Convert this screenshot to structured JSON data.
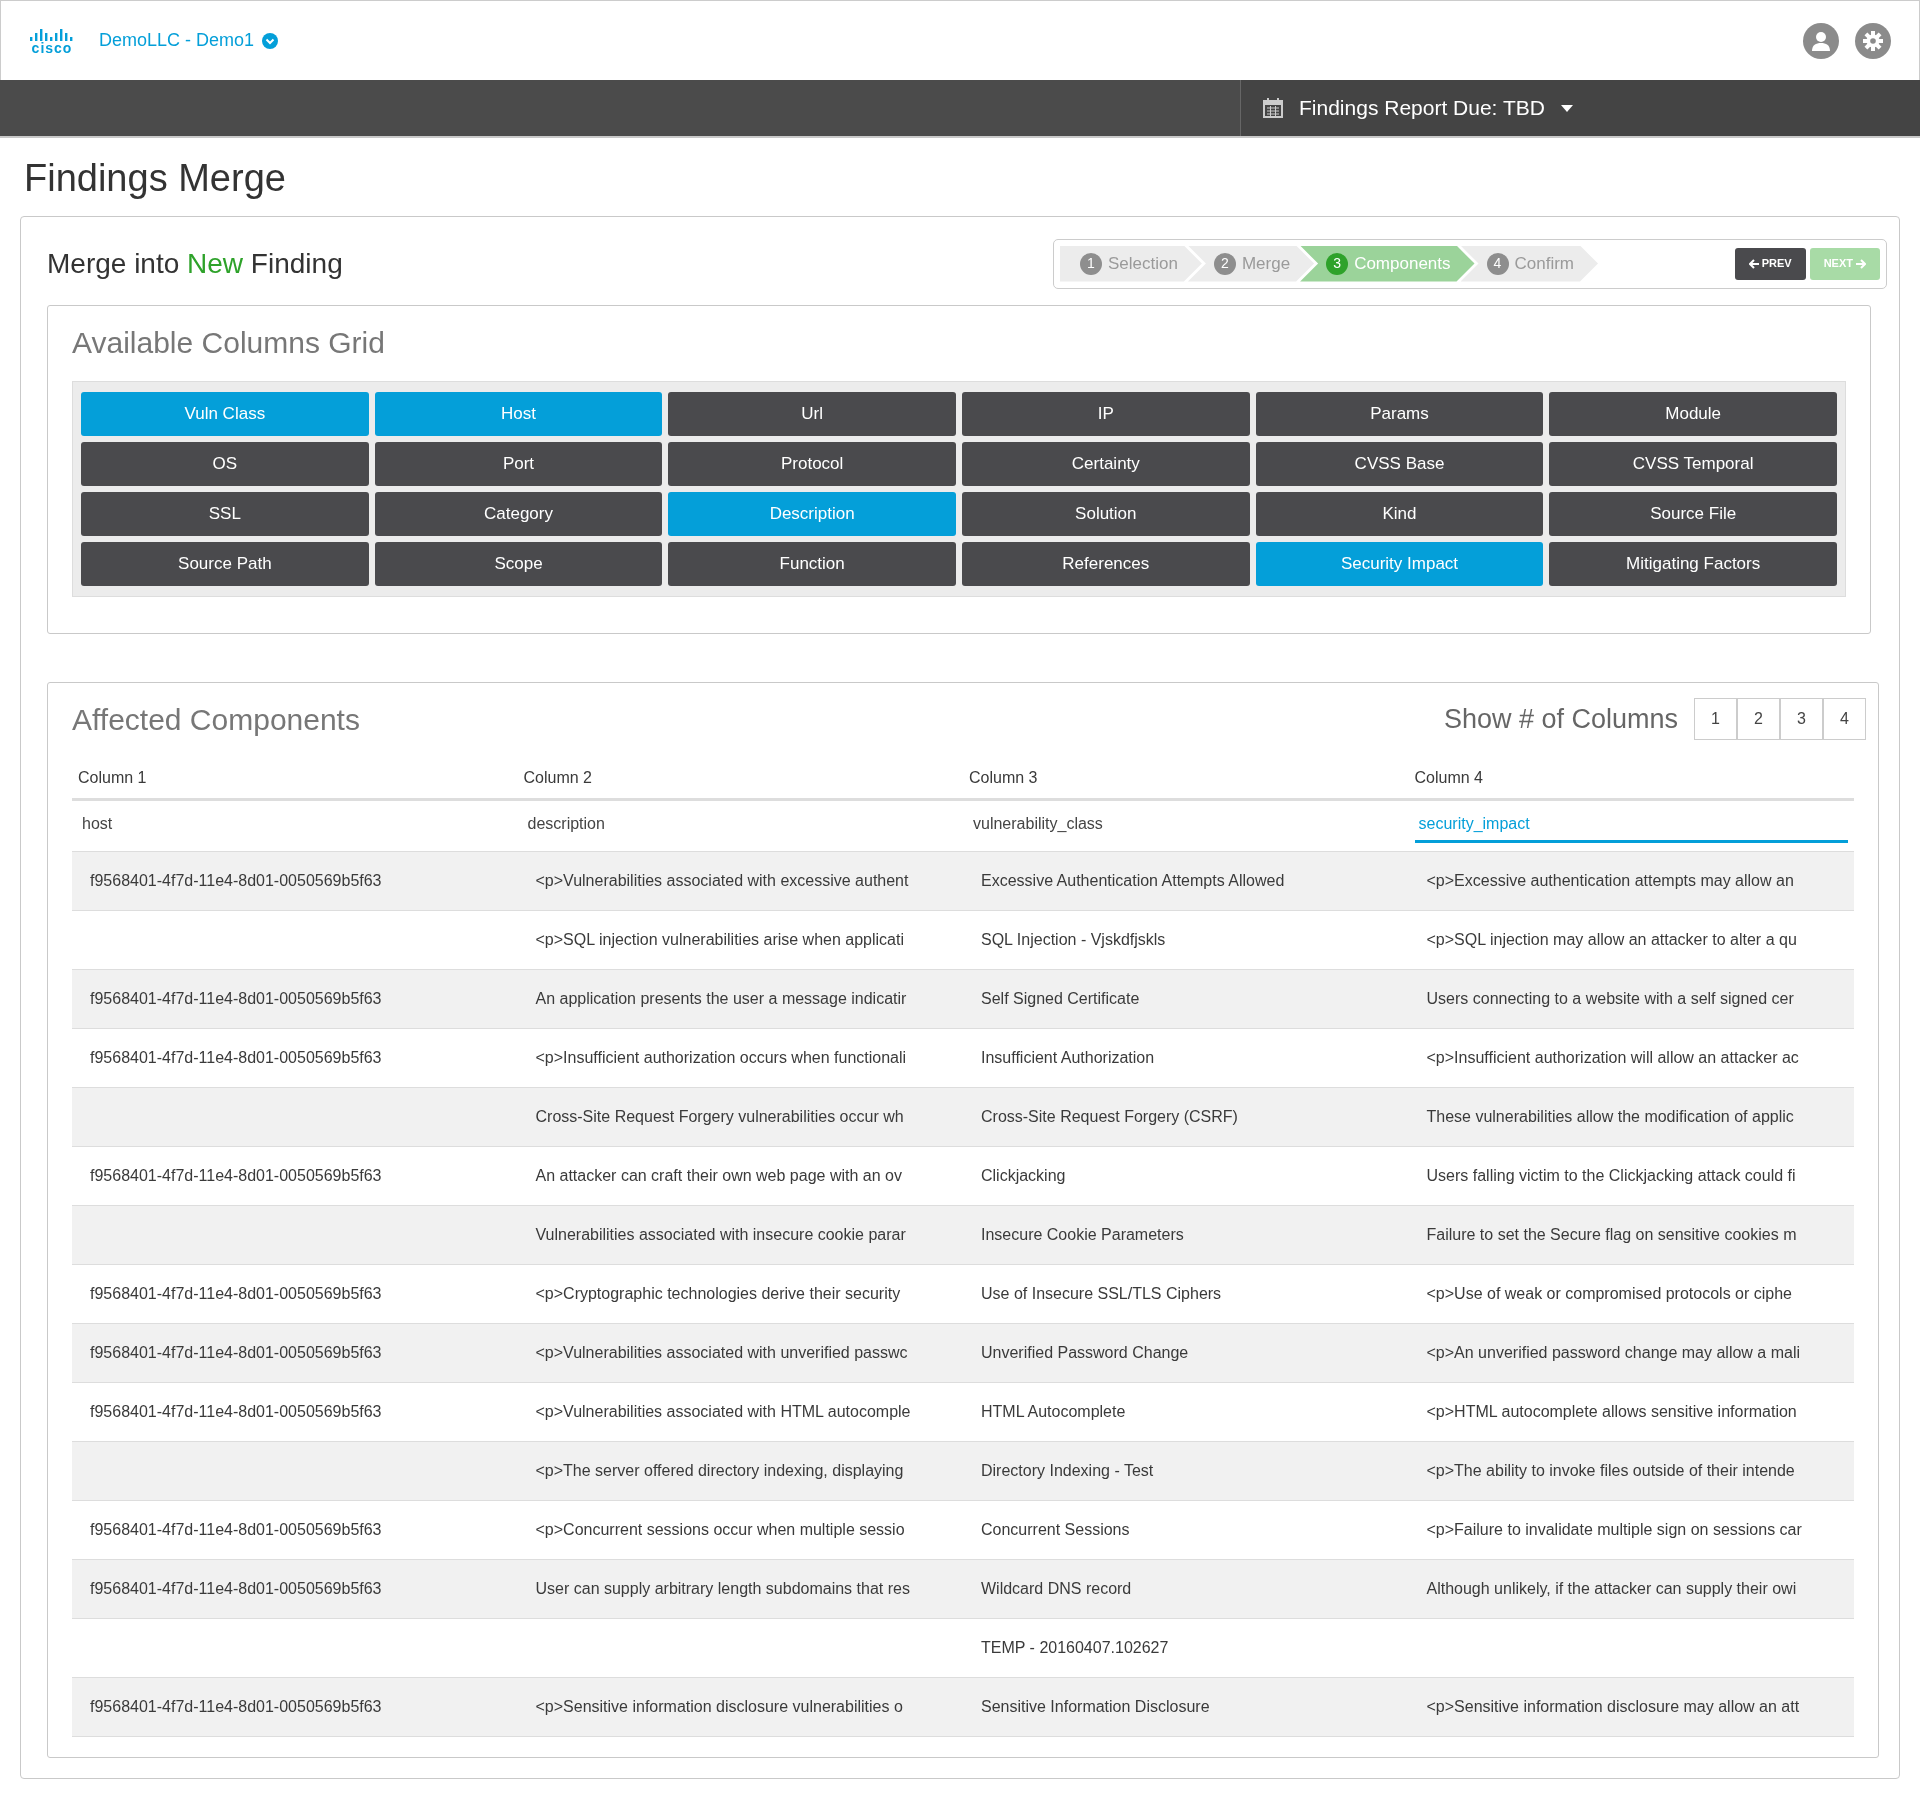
{
  "header": {
    "logo_text": "cisco",
    "workspace": "DemoLLC - Demo1"
  },
  "report_bar": {
    "label": "Findings Report Due: TBD"
  },
  "page_title": "Findings Merge",
  "merge_heading": {
    "prefix": "Merge into",
    "highlight": "New",
    "suffix": "Finding"
  },
  "wizard": {
    "steps": [
      {
        "number": "1",
        "label": "Selection",
        "selected": false
      },
      {
        "number": "2",
        "label": "Merge",
        "selected": false
      },
      {
        "number": "3",
        "label": "Components",
        "selected": true
      },
      {
        "number": "4",
        "label": "Confirm",
        "selected": false
      }
    ],
    "prev": {
      "label": "PREV",
      "disabled": false
    },
    "next": {
      "label": "NEXT",
      "disabled": true
    }
  },
  "columns_grid": {
    "title": "Available Columns Grid",
    "items": [
      {
        "label": "Vuln Class",
        "selected": true
      },
      {
        "label": "Host",
        "selected": true
      },
      {
        "label": "Url",
        "selected": false
      },
      {
        "label": "IP",
        "selected": false
      },
      {
        "label": "Params",
        "selected": false
      },
      {
        "label": "Module",
        "selected": false
      },
      {
        "label": "OS",
        "selected": false
      },
      {
        "label": "Port",
        "selected": false
      },
      {
        "label": "Protocol",
        "selected": false
      },
      {
        "label": "Certainty",
        "selected": false
      },
      {
        "label": "CVSS Base",
        "selected": false
      },
      {
        "label": "CVSS Temporal",
        "selected": false
      },
      {
        "label": "SSL",
        "selected": false
      },
      {
        "label": "Category",
        "selected": false
      },
      {
        "label": "Description",
        "selected": true
      },
      {
        "label": "Solution",
        "selected": false
      },
      {
        "label": "Kind",
        "selected": false
      },
      {
        "label": "Source File",
        "selected": false
      },
      {
        "label": "Source Path",
        "selected": false
      },
      {
        "label": "Scope",
        "selected": false
      },
      {
        "label": "Function",
        "selected": false
      },
      {
        "label": "References",
        "selected": false
      },
      {
        "label": "Security Impact",
        "selected": true
      },
      {
        "label": "Mitigating Factors",
        "selected": false
      }
    ]
  },
  "affected": {
    "title": "Affected Components",
    "column_count_label": "Show # of Columns",
    "column_count_options": [
      {
        "label": "1",
        "selected": false
      },
      {
        "label": "2",
        "selected": false
      },
      {
        "label": "3",
        "selected": false
      },
      {
        "label": "4",
        "selected": false
      }
    ],
    "columns": [
      "Column 1",
      "Column 2",
      "Column 3",
      "Column 4"
    ],
    "fields": [
      {
        "value": "host",
        "focused": false
      },
      {
        "value": "description",
        "focused": false
      },
      {
        "value": "vulnerability_class",
        "focused": false
      },
      {
        "value": "security_impact",
        "focused": true
      }
    ],
    "rows": [
      {
        "host": "f9568401-4f7d-11e4-8d01-0050569b5f63",
        "description": "<p>Vulnerabilities associated with excessive authent",
        "vulnerability_class": "Excessive Authentication Attempts Allowed",
        "security_impact": "<p>Excessive authentication attempts may allow an"
      },
      {
        "description": "<p>SQL injection vulnerabilities arise when applicati",
        "vulnerability_class": "SQL Injection - Vjskdfjskls",
        "security_impact": "<p>SQL injection may allow an attacker to alter a qu"
      },
      {
        "host": "f9568401-4f7d-11e4-8d01-0050569b5f63",
        "description": "An application presents the user a message indicatir",
        "vulnerability_class": "Self Signed Certificate",
        "security_impact": "Users connecting to a website with a self signed cer"
      },
      {
        "host": "f9568401-4f7d-11e4-8d01-0050569b5f63",
        "description": "<p>Insufficient authorization occurs when functionali",
        "vulnerability_class": "Insufficient Authorization",
        "security_impact": "<p>Insufficient authorization will allow an attacker ac"
      },
      {
        "description": "Cross-Site Request Forgery vulnerabilities occur wh",
        "vulnerability_class": "Cross-Site Request Forgery (CSRF)",
        "security_impact": "These vulnerabilities allow the modification of applic"
      },
      {
        "host": "f9568401-4f7d-11e4-8d01-0050569b5f63",
        "description": "An attacker can craft their own web page with an ov",
        "vulnerability_class": "Clickjacking",
        "security_impact": "Users falling victim to the Clickjacking attack could fi"
      },
      {
        "description": "Vulnerabilities associated with insecure cookie parar",
        "vulnerability_class": "Insecure Cookie Parameters",
        "security_impact": "Failure to set the Secure flag on sensitive cookies m"
      },
      {
        "host": "f9568401-4f7d-11e4-8d01-0050569b5f63",
        "description": "<p>Cryptographic technologies derive their security",
        "vulnerability_class": "Use of Insecure SSL/TLS Ciphers",
        "security_impact": "<p>Use of weak or compromised protocols or ciphe"
      },
      {
        "host": "f9568401-4f7d-11e4-8d01-0050569b5f63",
        "description": "<p>Vulnerabilities associated with unverified passwc",
        "vulnerability_class": "Unverified Password Change",
        "security_impact": "<p>An unverified password change may allow a mali"
      },
      {
        "host": "f9568401-4f7d-11e4-8d01-0050569b5f63",
        "description": "<p>Vulnerabilities associated with HTML autocomple",
        "vulnerability_class": "HTML Autocomplete",
        "security_impact": "<p>HTML autocomplete allows sensitive information"
      },
      {
        "description": "<p>The server offered directory indexing, displaying",
        "vulnerability_class": "Directory Indexing - Test",
        "security_impact": "<p>The ability to invoke files outside of their intende"
      },
      {
        "host": "f9568401-4f7d-11e4-8d01-0050569b5f63",
        "description": "<p>Concurrent sessions occur when multiple sessio",
        "vulnerability_class": "Concurrent Sessions",
        "security_impact": "<p>Failure to invalidate multiple sign on sessions car"
      },
      {
        "host": "f9568401-4f7d-11e4-8d01-0050569b5f63",
        "description": "User can supply arbitrary length subdomains that res",
        "vulnerability_class": "Wildcard DNS record",
        "security_impact": "Although unlikely, if the attacker can supply their owi"
      },
      {
        "vulnerability_class": "TEMP - 20160407.102627"
      },
      {
        "host": "f9568401-4f7d-11e4-8d01-0050569b5f63",
        "description": "<p>Sensitive information disclosure vulnerabilities o",
        "vulnerability_class": "Sensitive Information Disclosure",
        "security_impact": "<p>Sensitive information disclosure may allow an att"
      }
    ]
  }
}
